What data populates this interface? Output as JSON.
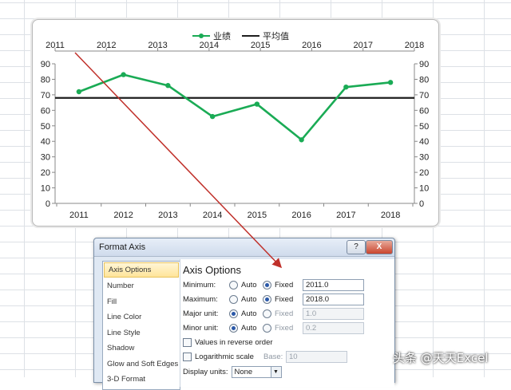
{
  "chart": {
    "legend": {
      "series1": "业绩",
      "series2": "平均值"
    },
    "top_axis_labels": [
      "2011",
      "2012",
      "2013",
      "2014",
      "2015",
      "2016",
      "2017",
      "2018"
    ],
    "bottom_axis_labels": [
      "2011",
      "2012",
      "2013",
      "2014",
      "2015",
      "2016",
      "2017",
      "2018"
    ],
    "y_ticks": [
      "0",
      "10",
      "20",
      "30",
      "40",
      "50",
      "60",
      "70",
      "80",
      "90"
    ],
    "colors": {
      "series1": "#1aab55",
      "average": "#1e1e1e",
      "arrow": "#c0302a"
    }
  },
  "chart_data": {
    "type": "line",
    "x": [
      "2011",
      "2012",
      "2013",
      "2014",
      "2015",
      "2016",
      "2017",
      "2018"
    ],
    "series": [
      {
        "name": "业绩",
        "values": [
          72,
          83,
          76,
          56,
          64,
          41,
          75,
          78
        ]
      },
      {
        "name": "平均值",
        "values": [
          68,
          68,
          68,
          68,
          68,
          68,
          68,
          68
        ]
      }
    ],
    "ylim": [
      0,
      90
    ],
    "grid": false,
    "legend": "top"
  },
  "dialog": {
    "title": "Format Axis",
    "help": "?",
    "close": "X",
    "nav": [
      "Axis Options",
      "Number",
      "Fill",
      "Line Color",
      "Line Style",
      "Shadow",
      "Glow and Soft Edges",
      "3-D Format"
    ],
    "section_title": "Axis Options",
    "minimum": {
      "label": "Minimum:",
      "auto": "Auto",
      "fixed": "Fixed",
      "value": "2011.0"
    },
    "maximum": {
      "label": "Maximum:",
      "auto": "Auto",
      "fixed": "Fixed",
      "value": "2018.0"
    },
    "major": {
      "label": "Major unit:",
      "auto": "Auto",
      "fixed": "Fixed",
      "value": "1.0"
    },
    "minor": {
      "label": "Minor unit:",
      "auto": "Auto",
      "fixed": "Fixed",
      "value": "0.2"
    },
    "reverse": "Values in reverse order",
    "log_scale": "Logarithmic scale",
    "base_label": "Base:",
    "base_value": "10",
    "display_units_label": "Display units:",
    "display_units_value": "None"
  },
  "watermark": "头条 @天天Excel"
}
